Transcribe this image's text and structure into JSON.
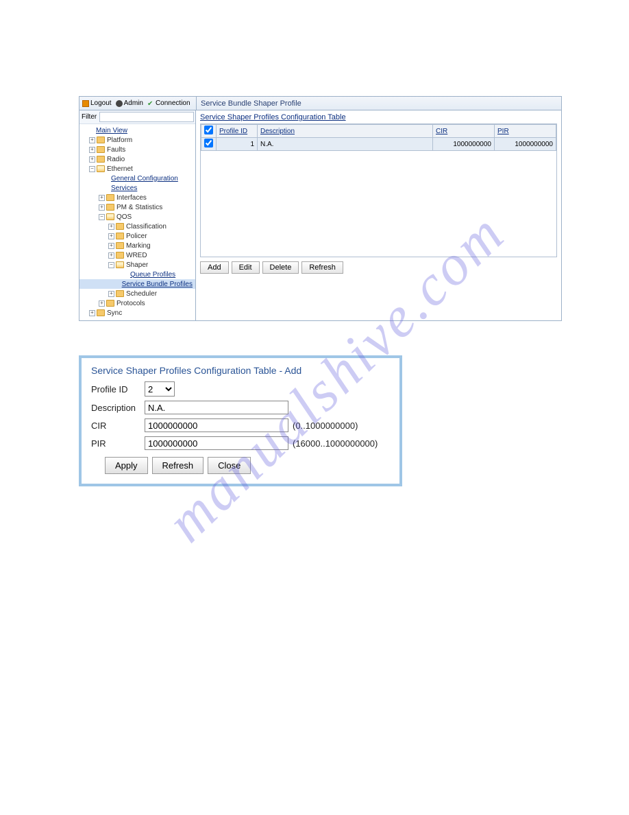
{
  "watermark": "manualshive.com",
  "toolbar": {
    "logout": "Logout",
    "admin": "Admin",
    "connection": "Connection"
  },
  "page_title": "Service Bundle Shaper Profile",
  "filter_label": "Filter",
  "filter_value": "",
  "filter_clear": "×",
  "tree": {
    "main_view": "Main View",
    "platform": "Platform",
    "faults": "Faults",
    "radio": "Radio",
    "ethernet": "Ethernet",
    "general_config": "General Configuration",
    "services": "Services",
    "interfaces": "Interfaces",
    "pm_stats": "PM & Statistics",
    "qos": "QOS",
    "classification": "Classification",
    "policer": "Policer",
    "marking": "Marking",
    "wred": "WRED",
    "shaper": "Shaper",
    "queue_profiles": "Queue Profiles",
    "service_bundle_profiles": "Service Bundle Profiles",
    "scheduler": "Scheduler",
    "protocols": "Protocols",
    "sync": "Sync"
  },
  "section_title": "Service Shaper Profiles Configuration Table",
  "table": {
    "headers": {
      "profile_id": "Profile ID",
      "description": "Description",
      "cir": "CIR",
      "pir": "PIR"
    },
    "rows": [
      {
        "checked": true,
        "profile_id": "1",
        "description": "N.A.",
        "cir": "1000000000",
        "pir": "1000000000"
      }
    ]
  },
  "buttons": {
    "add": "Add",
    "edit": "Edit",
    "delete": "Delete",
    "refresh": "Refresh"
  },
  "dialog": {
    "title": "Service Shaper Profiles Configuration Table - Add",
    "profile_id_label": "Profile ID",
    "profile_id_value": "2",
    "description_label": "Description",
    "description_value": "N.A.",
    "cir_label": "CIR",
    "cir_value": "1000000000",
    "cir_hint": "(0..1000000000)",
    "pir_label": "PIR",
    "pir_value": "1000000000",
    "pir_hint": "(16000..1000000000)",
    "apply": "Apply",
    "refresh": "Refresh",
    "close": "Close"
  }
}
